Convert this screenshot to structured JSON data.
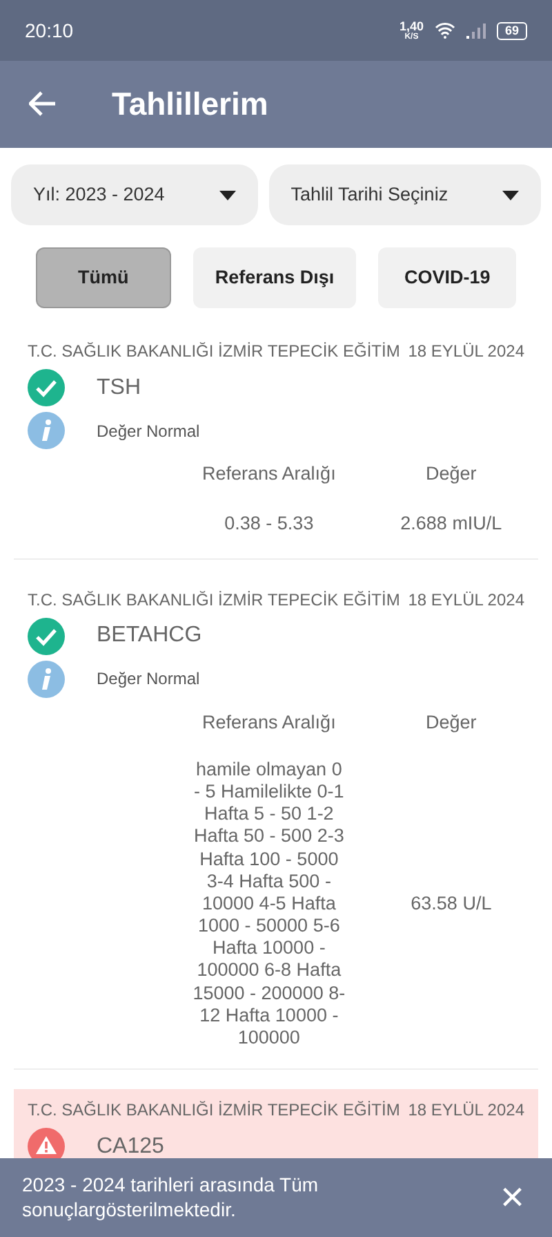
{
  "status_bar": {
    "time": "20:10",
    "speed": "1,40",
    "speed_unit": "K/S",
    "battery": "69"
  },
  "app_bar": {
    "title": "Tahlillerim"
  },
  "dropdowns": [
    {
      "label": "Yıl: 2023 - 2024"
    },
    {
      "label": "Tahlil Tarihi Seçiniz"
    }
  ],
  "filters": [
    {
      "label": "Tümü",
      "selected": true
    },
    {
      "label": "Referans Dışı",
      "selected": false
    },
    {
      "label": "COVID-19",
      "selected": false
    }
  ],
  "results": [
    {
      "kind": "normal",
      "hospital": "T.C. SAĞLIK BAKANLIĞI İZMİR TEPECİK EĞİTİM",
      "date": "18 EYLÜL 2024",
      "test": "TSH",
      "note": "Değer Normal",
      "range_label": "Referans Aralığı",
      "value_label": "Değer",
      "range": "0.38 - 5.33",
      "value": "2.688 mIU/L"
    },
    {
      "kind": "normal",
      "hospital": "T.C. SAĞLIK BAKANLIĞI İZMİR TEPECİK EĞİTİM",
      "date": "18 EYLÜL 2024",
      "test": "BETAHCG",
      "note": "Değer Normal",
      "range_label": "Referans Aralığı",
      "value_label": "Değer",
      "range": "hamile olmayan 0 - 5 Hamilelikte 0-1 Hafta 5 - 50 1-2 Hafta 50 - 500 2-3 Hafta 100 - 5000 3-4 Hafta 500 - 10000 4-5 Hafta 1000 - 50000 5-6 Hafta 10000 - 100000 6-8 Hafta 15000 - 200000 8-12 Hafta 10000 - 100000",
      "value": "63.58 U/L"
    },
    {
      "kind": "abnormal",
      "hospital": "T.C. SAĞLIK BAKANLIĞI İZMİR TEPECİK EĞİTİM",
      "date": "18 EYLÜL 2024",
      "test": "CA125"
    }
  ],
  "snackbar": {
    "message": "2023 - 2024 tarihleri arasında Tüm sonuçlargösterilmektedir.",
    "close": "×"
  }
}
